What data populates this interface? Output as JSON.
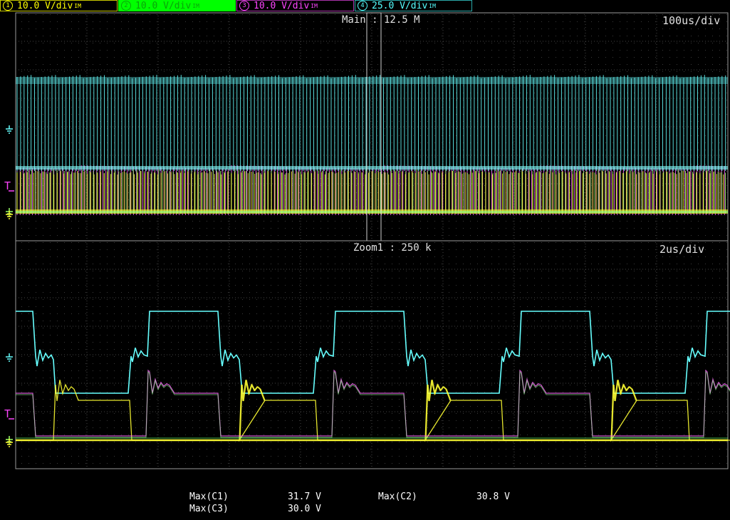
{
  "channels": [
    {
      "label": "10.0 V/div",
      "num": "1",
      "color": "#ffff00"
    },
    {
      "label": "10.0 V/div",
      "num": "2",
      "color": "#00ff00"
    },
    {
      "label": "10.0 V/div",
      "num": "3",
      "color": "#ff44ff"
    },
    {
      "label": "25.0 V/div",
      "num": "4",
      "color": "#55ffff"
    }
  ],
  "main": {
    "label": "Main : 12.5 M",
    "timebase": "100us/div"
  },
  "zoom": {
    "label": "Zoom1 : 250 k",
    "timebase": "2us/div"
  },
  "measurements": {
    "max_c1_label": "Max(C1)",
    "max_c1_value": "31.7 V",
    "max_c2_label": "Max(C2)",
    "max_c2_value": "30.8 V",
    "max_c3_label": "Max(C3)",
    "max_c3_value": "30.0 V"
  },
  "markers": {
    "trigger": "T"
  }
}
